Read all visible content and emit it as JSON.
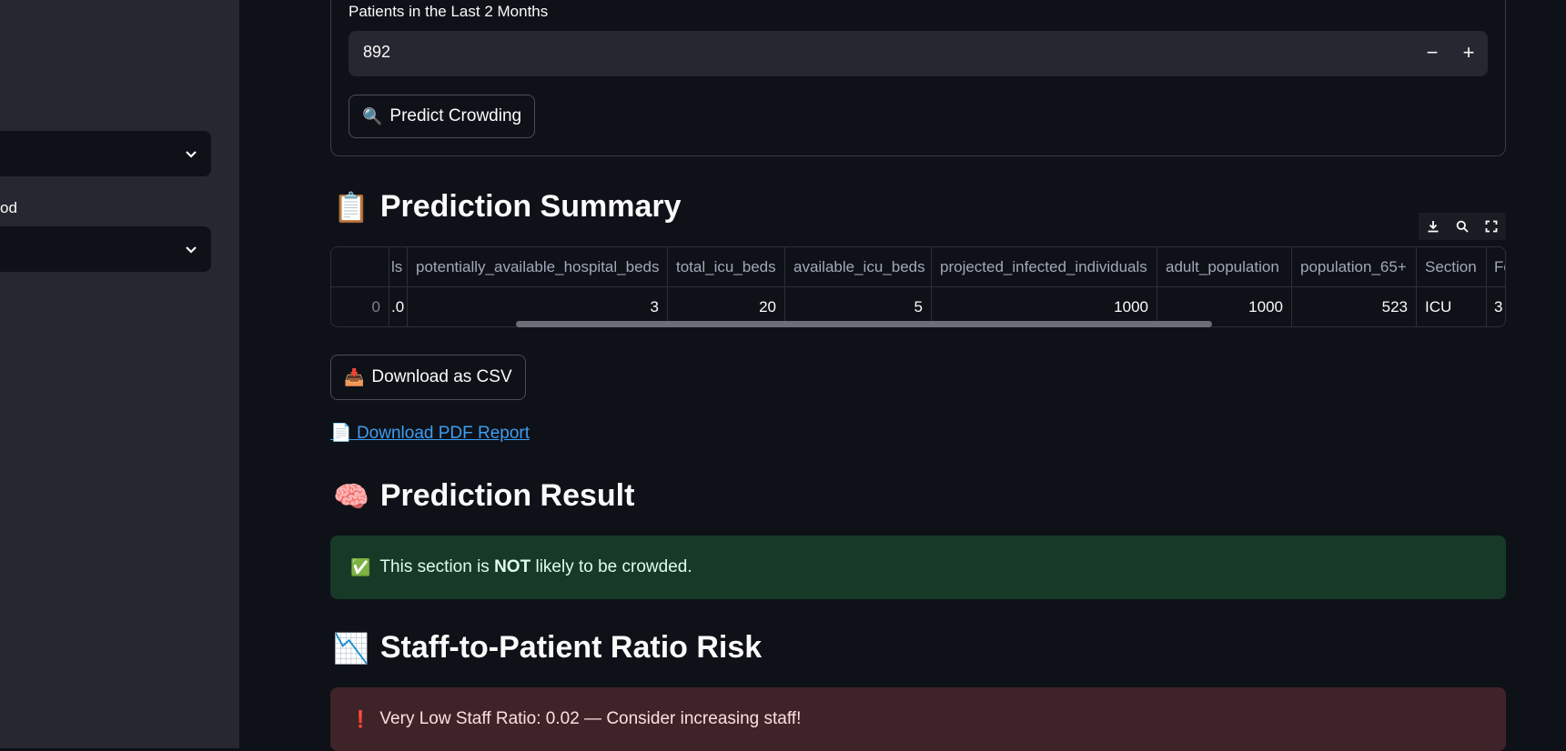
{
  "sidebar": {
    "select1": {
      "value": ""
    },
    "label2": "od",
    "select2": {
      "value": ""
    }
  },
  "form": {
    "label": "Patients in the Last 2 Months",
    "value": "892",
    "decrement": "−",
    "increment": "+",
    "predict_button": "Predict Crowding",
    "predict_icon": "🔍"
  },
  "summary": {
    "title": "Prediction Summary",
    "icon": "📋",
    "toolbar": [
      "download-icon",
      "search-icon",
      "fullscreen-icon"
    ],
    "columns": [
      "ls",
      "potentially_available_hospital_beds",
      "total_icu_beds",
      "available_icu_beds",
      "projected_infected_individuals",
      "adult_population",
      "population_65+",
      "Section",
      "Fo"
    ],
    "row_index": "0",
    "row": [
      ".0",
      "3",
      "20",
      "5",
      "1000",
      "1000",
      "523",
      "ICU",
      "3"
    ]
  },
  "download_csv": {
    "label": "Download as CSV",
    "icon": "📥"
  },
  "download_pdf": {
    "label": "Download PDF Report",
    "icon": "📄"
  },
  "result": {
    "title": "Prediction Result",
    "icon": "🧠",
    "message_before": "This section is ",
    "message_bold": "NOT",
    "message_after": " likely to be crowded.",
    "message_icon": "✅"
  },
  "staff": {
    "title": "Staff-to-Patient Ratio Risk",
    "icon": "📉",
    "message": "Very Low Staff Ratio: 0.02 — Consider increasing staff!",
    "message_icon": "❗"
  }
}
